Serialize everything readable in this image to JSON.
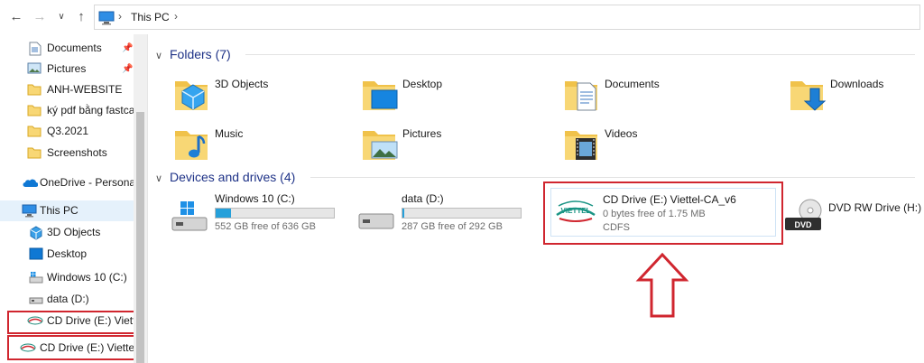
{
  "address": {
    "crumb": "This PC",
    "nav_icons": [
      "back-arrow-icon",
      "forward-arrow-icon",
      "recent-chevron-icon",
      "up-arrow-icon"
    ]
  },
  "nav": {
    "items": [
      {
        "label": "Documents",
        "icon": "documents-icon",
        "pinned": true
      },
      {
        "label": "Pictures",
        "icon": "pictures-icon",
        "pinned": true
      },
      {
        "label": "ANH-WEBSITE",
        "icon": "folder-icon",
        "pinned": false
      },
      {
        "label": "ký pdf bằng fastca",
        "icon": "folder-icon",
        "pinned": false
      },
      {
        "label": "Q3.2021",
        "icon": "folder-icon",
        "pinned": false
      },
      {
        "label": "Screenshots",
        "icon": "folder-icon",
        "pinned": false
      },
      {
        "label": "OneDrive - Personal",
        "icon": "onedrive-icon",
        "pinned": false
      },
      {
        "label": "This PC",
        "icon": "this-pc-icon",
        "pinned": false,
        "selected": true
      },
      {
        "label": "3D Objects",
        "icon": "3d-objects-icon",
        "pinned": false
      },
      {
        "label": "Desktop",
        "icon": "desktop-icon",
        "pinned": false
      },
      {
        "label": "Windows 10 (C:)",
        "icon": "windows-drive-icon",
        "pinned": false
      },
      {
        "label": "data (D:)",
        "icon": "drive-icon",
        "pinned": false
      },
      {
        "label": "CD Drive (E:) Viette",
        "icon": "cd-drive-icon",
        "pinned": false
      },
      {
        "label": "CD Drive (E:) Viettel-",
        "icon": "cd-drive-icon",
        "pinned": false
      }
    ],
    "pin_glyph": "📌"
  },
  "folders": {
    "header": "Folders (7)",
    "items": [
      {
        "label": "3D Objects",
        "icon": "3d-objects-folder-icon"
      },
      {
        "label": "Desktop",
        "icon": "desktop-folder-icon"
      },
      {
        "label": "Documents",
        "icon": "documents-folder-icon"
      },
      {
        "label": "Downloads",
        "icon": "downloads-folder-icon"
      },
      {
        "label": "Music",
        "icon": "music-folder-icon"
      },
      {
        "label": "Pictures",
        "icon": "pictures-folder-icon"
      },
      {
        "label": "Videos",
        "icon": "videos-folder-icon"
      }
    ]
  },
  "drives": {
    "header": "Devices and drives (4)",
    "items": [
      {
        "label": "Windows 10 (C:)",
        "free": "552 GB free of 636 GB",
        "used_fraction": 0.132,
        "icon": "windows-drive-icon"
      },
      {
        "label": "data (D:)",
        "free": "287 GB free of 292 GB",
        "used_fraction": 0.017,
        "icon": "drive-icon"
      },
      {
        "label": "CD Drive (E:) Viettel-CA_v6",
        "free": "0 bytes free of 1.75 MB",
        "filesystem": "CDFS",
        "icon": "viettel-cd-icon",
        "logo_text": "VIETTEL"
      },
      {
        "label": "DVD RW Drive (H:)",
        "icon": "dvd-drive-icon",
        "badge": "DVD"
      }
    ]
  },
  "colors": {
    "accent": "#26a0da",
    "header_text": "#1e3287",
    "highlight_red": "#d0262f",
    "selection": "#e5f1fb"
  }
}
